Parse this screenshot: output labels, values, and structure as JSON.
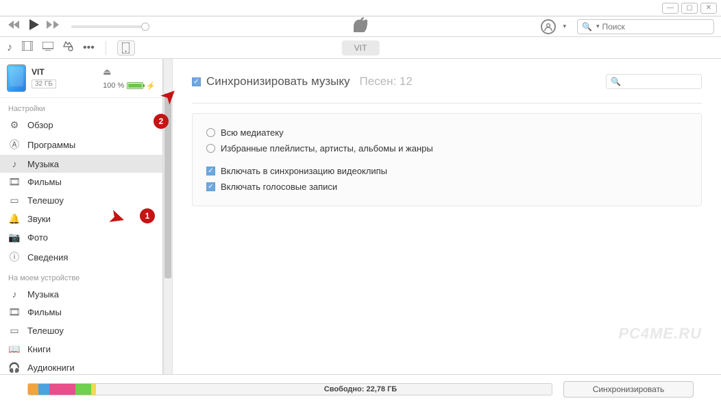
{
  "search_placeholder": "Поиск",
  "device_tab": "VIT",
  "device": {
    "name": "VIT",
    "capacity": "32 ГБ",
    "battery_pct": "100 %"
  },
  "sidebar": {
    "settings_heading": "Настройки",
    "settings": [
      {
        "icon": "settings-icon",
        "label": "Обзор"
      },
      {
        "icon": "apps-icon",
        "label": "Программы"
      },
      {
        "icon": "music-icon",
        "label": "Музыка"
      },
      {
        "icon": "movies-icon",
        "label": "Фильмы"
      },
      {
        "icon": "tv-icon",
        "label": "Телешоу"
      },
      {
        "icon": "tones-icon",
        "label": "Звуки"
      },
      {
        "icon": "photos-icon",
        "label": "Фото"
      },
      {
        "icon": "info-icon",
        "label": "Сведения"
      }
    ],
    "ondevice_heading": "На моем устройстве",
    "ondevice": [
      {
        "icon": "music-icon",
        "label": "Музыка"
      },
      {
        "icon": "movies-icon",
        "label": "Фильмы"
      },
      {
        "icon": "tv-icon",
        "label": "Телешоу"
      },
      {
        "icon": "books-icon",
        "label": "Книги"
      },
      {
        "icon": "audiobooks-icon",
        "label": "Аудиокниги"
      }
    ]
  },
  "content": {
    "sync_label": "Синхронизировать музыку",
    "song_count": "Песен: 12",
    "radio_all": "Всю медиатеку",
    "radio_selected": "Избранные плейлисты, артисты, альбомы и жанры",
    "chk_videos": "Включать в синхронизацию видеоклипы",
    "chk_voice": "Включать голосовые записи"
  },
  "bottom": {
    "free_label": "Свободно: 22,78 ГБ",
    "sync_btn": "Синхронизировать",
    "segments": [
      {
        "color": "#f2a33c",
        "pct": 2
      },
      {
        "color": "#4aa3e0",
        "pct": 2
      },
      {
        "color": "#e94f8a",
        "pct": 5
      },
      {
        "color": "#6fcf4f",
        "pct": 3
      },
      {
        "color": "#f2d94f",
        "pct": 1
      },
      {
        "color": "#f4f4f4",
        "pct": 87
      }
    ]
  },
  "watermark": "PC4ME.RU",
  "annotations": {
    "badge1": "1",
    "badge2": "2"
  }
}
